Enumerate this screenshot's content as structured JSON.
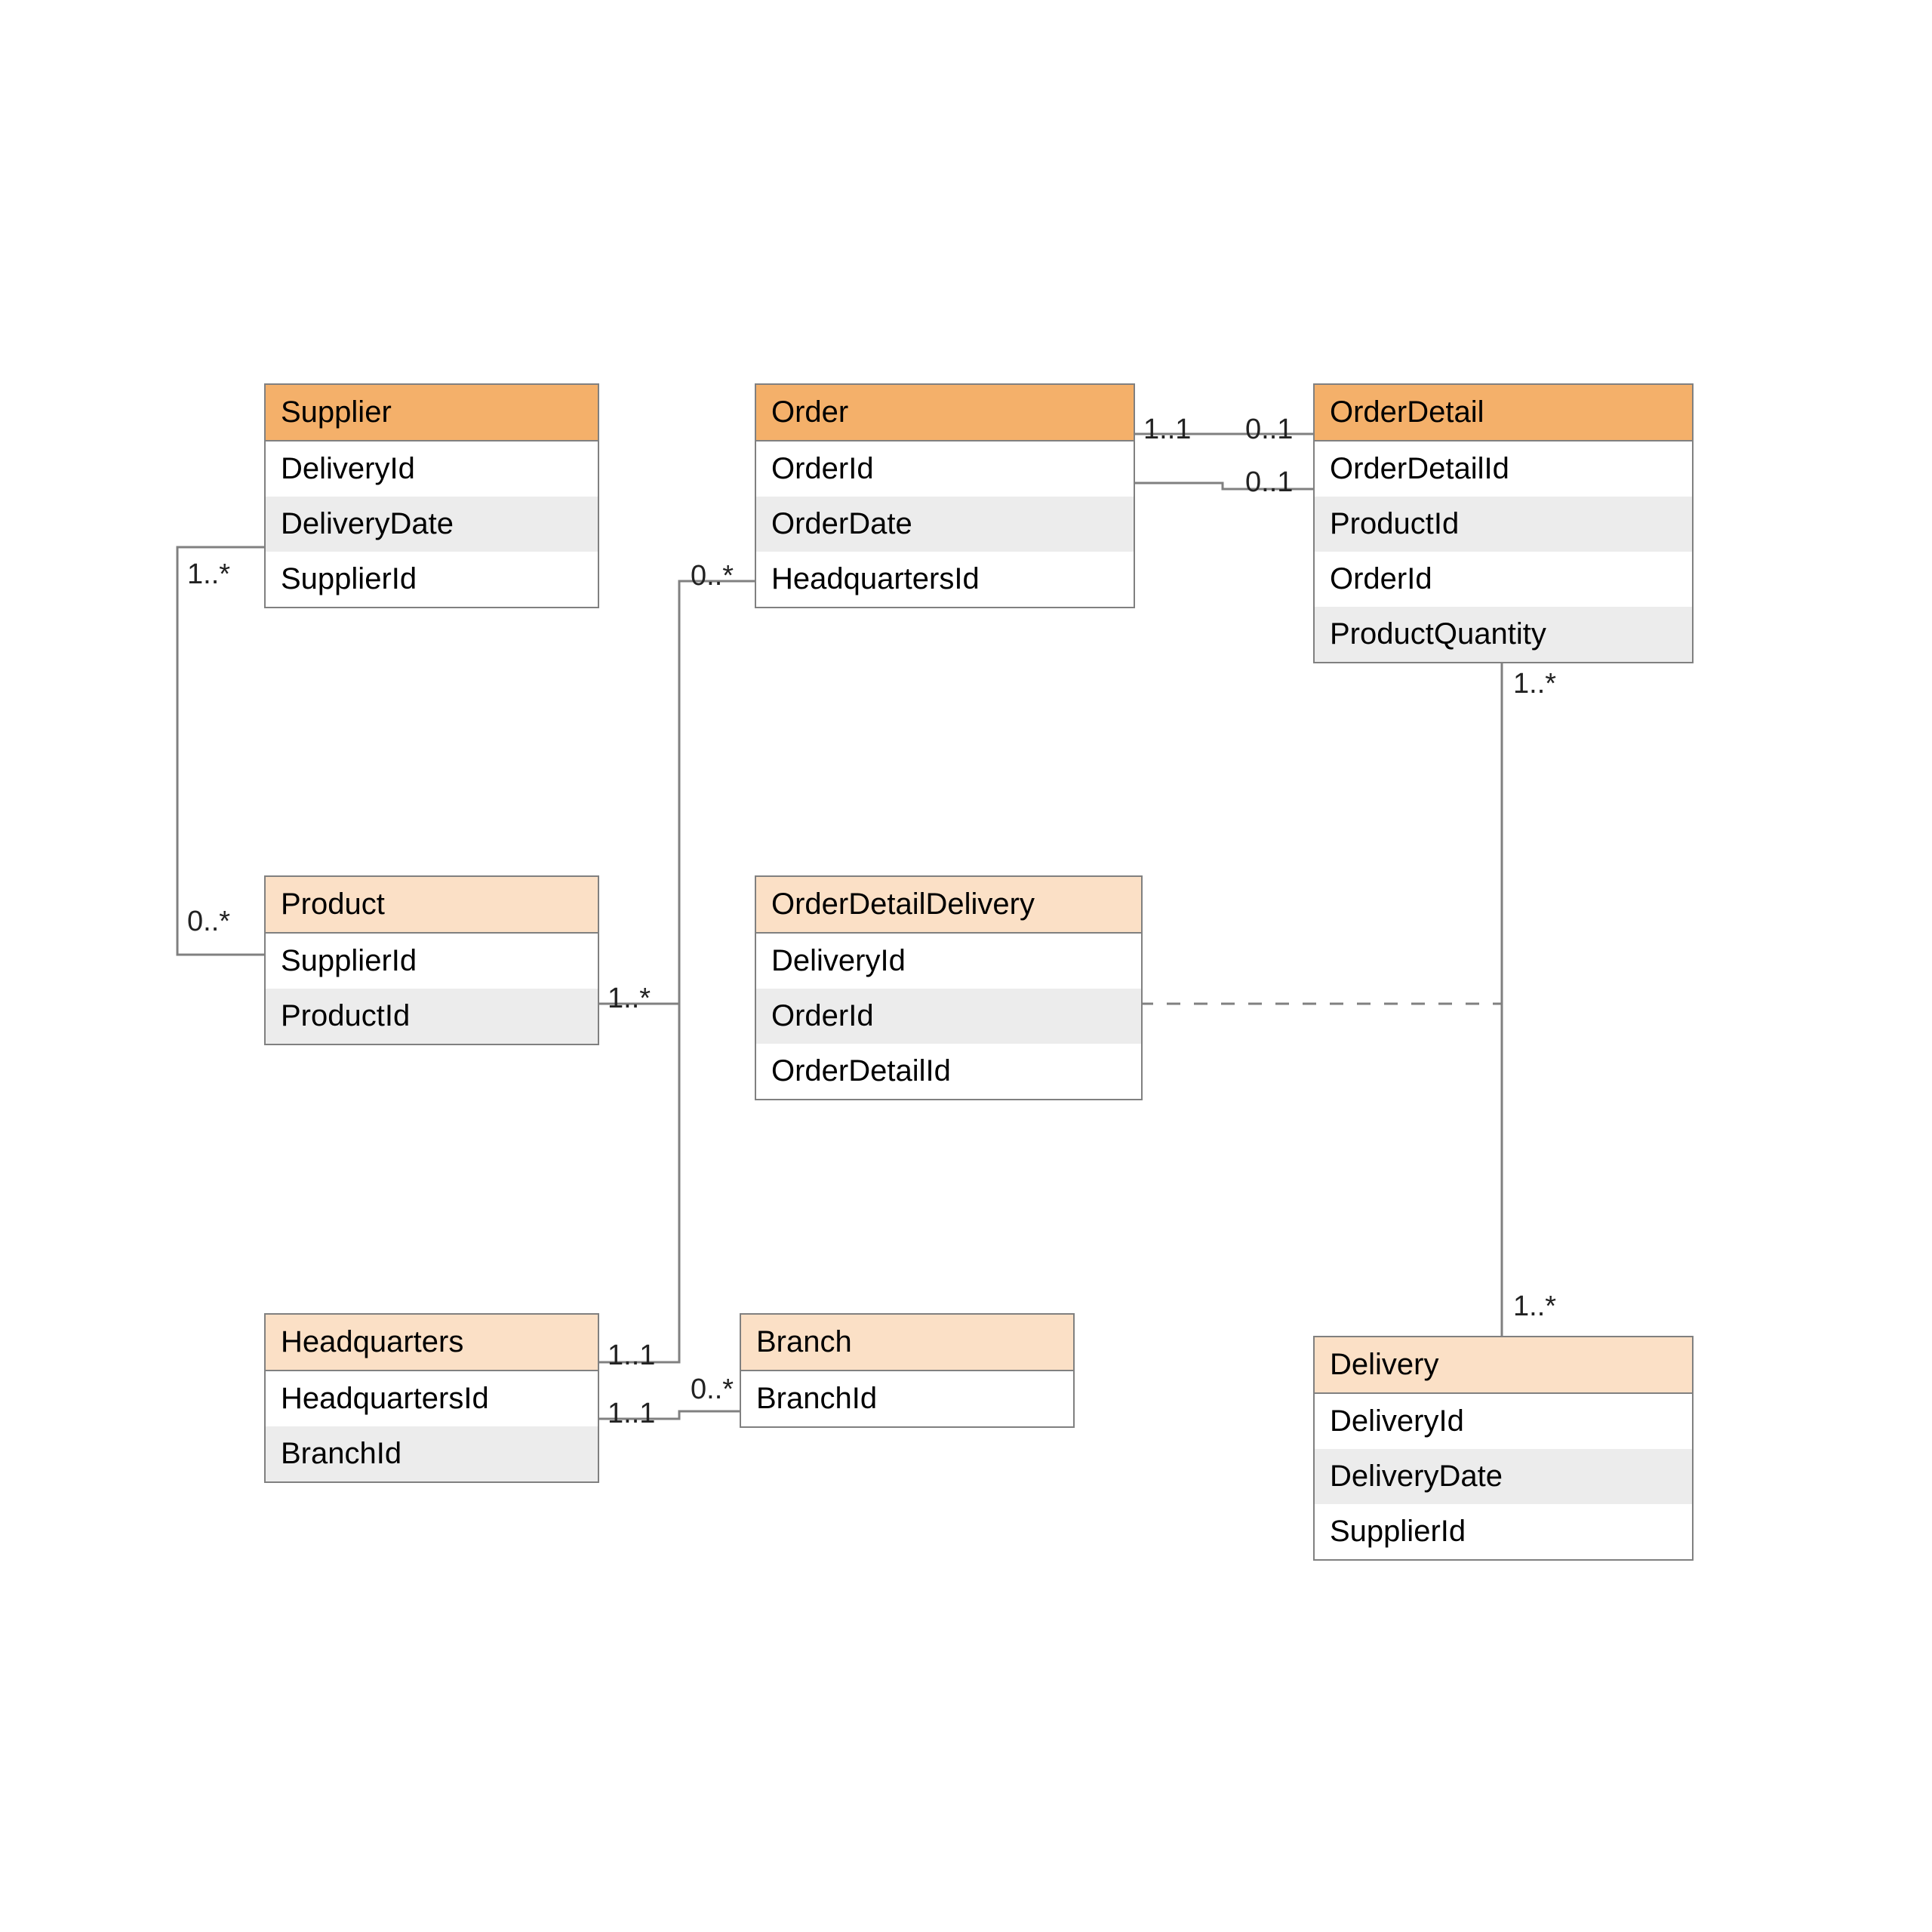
{
  "entities": {
    "supplier": {
      "title": "Supplier",
      "attrs": [
        "DeliveryId",
        "DeliveryDate",
        "SupplierId"
      ]
    },
    "order": {
      "title": "Order",
      "attrs": [
        "OrderId",
        "OrderDate",
        "HeadquartersId"
      ]
    },
    "orderDetail": {
      "title": "OrderDetail",
      "attrs": [
        "OrderDetailId",
        "ProductId",
        "OrderId",
        "ProductQuantity"
      ]
    },
    "product": {
      "title": "Product",
      "attrs": [
        "SupplierId",
        "ProductId"
      ]
    },
    "orderDetailDelivery": {
      "title": "OrderDetailDelivery",
      "attrs": [
        "DeliveryId",
        "OrderId",
        "OrderDetailId"
      ]
    },
    "headquarters": {
      "title": "Headquarters",
      "attrs": [
        "HeadquartersId",
        "BranchId"
      ]
    },
    "branch": {
      "title": "Branch",
      "attrs": [
        "BranchId"
      ]
    },
    "delivery": {
      "title": "Delivery",
      "attrs": [
        "DeliveryId",
        "DeliveryDate",
        "SupplierId"
      ]
    }
  },
  "multiplicities": {
    "supplier_side": "1..*",
    "product_supplier_side": "0..*",
    "product_right": "1..*",
    "order_left": "0..*",
    "order_right": "1..1",
    "orderDetail_topLeft": "0..1",
    "orderDetail_left2": "0..1",
    "orderDetail_bottom": "1..*",
    "delivery_top": "1..*",
    "hq_right_top": "1..1",
    "hq_right_bottom": "1..1",
    "branch_left": "0..*"
  }
}
